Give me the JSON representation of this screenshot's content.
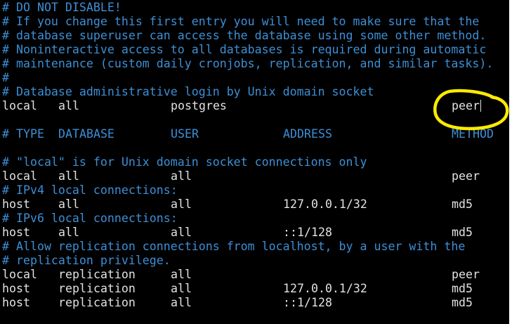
{
  "terminal": {
    "comments_top": [
      "# DO NOT DISABLE!",
      "# If you change this first entry you will need to make sure that the",
      "# database superuser can access the database using some other method.",
      "# Noninteractive access to all databases is required during automatic",
      "# maintenance (custom daily cronjobs, replication, and similar tasks).",
      "#",
      "# Database administrative login by Unix domain socket"
    ],
    "admin_entry": {
      "type": "local",
      "database": "all",
      "user": "postgres",
      "method": "peer"
    },
    "header": {
      "hash_type": "# TYPE",
      "database": "DATABASE",
      "user": "USER",
      "address": "ADDRESS",
      "method": "METHOD"
    },
    "section_local_comment": "# \"local\" is for Unix domain socket connections only",
    "local_entry": {
      "type": "local",
      "database": "all",
      "user": "all",
      "address": "",
      "method": "peer"
    },
    "ipv4_comment": "# IPv4 local connections:",
    "ipv4_entry": {
      "type": "host",
      "database": "all",
      "user": "all",
      "address": "127.0.0.1/32",
      "method": "md5"
    },
    "ipv6_comment": "# IPv6 local connections:",
    "ipv6_entry": {
      "type": "host",
      "database": "all",
      "user": "all",
      "address": "::1/128",
      "method": "md5"
    },
    "replication_comment_1": "# Allow replication connections from localhost, by a user with the",
    "replication_comment_2": "# replication privilege.",
    "replication_entries": [
      {
        "type": "local",
        "database": "replication",
        "user": "all",
        "address": "",
        "method": "peer"
      },
      {
        "type": "host",
        "database": "replication",
        "user": "all",
        "address": "127.0.0.1/32",
        "method": "md5"
      },
      {
        "type": "host",
        "database": "replication",
        "user": "all",
        "address": "::1/128",
        "method": "md5"
      }
    ]
  },
  "colors": {
    "background": "#000000",
    "comment": "#3d8fd6",
    "text": "#e2e2e2",
    "annotation": "#ffeb00"
  }
}
